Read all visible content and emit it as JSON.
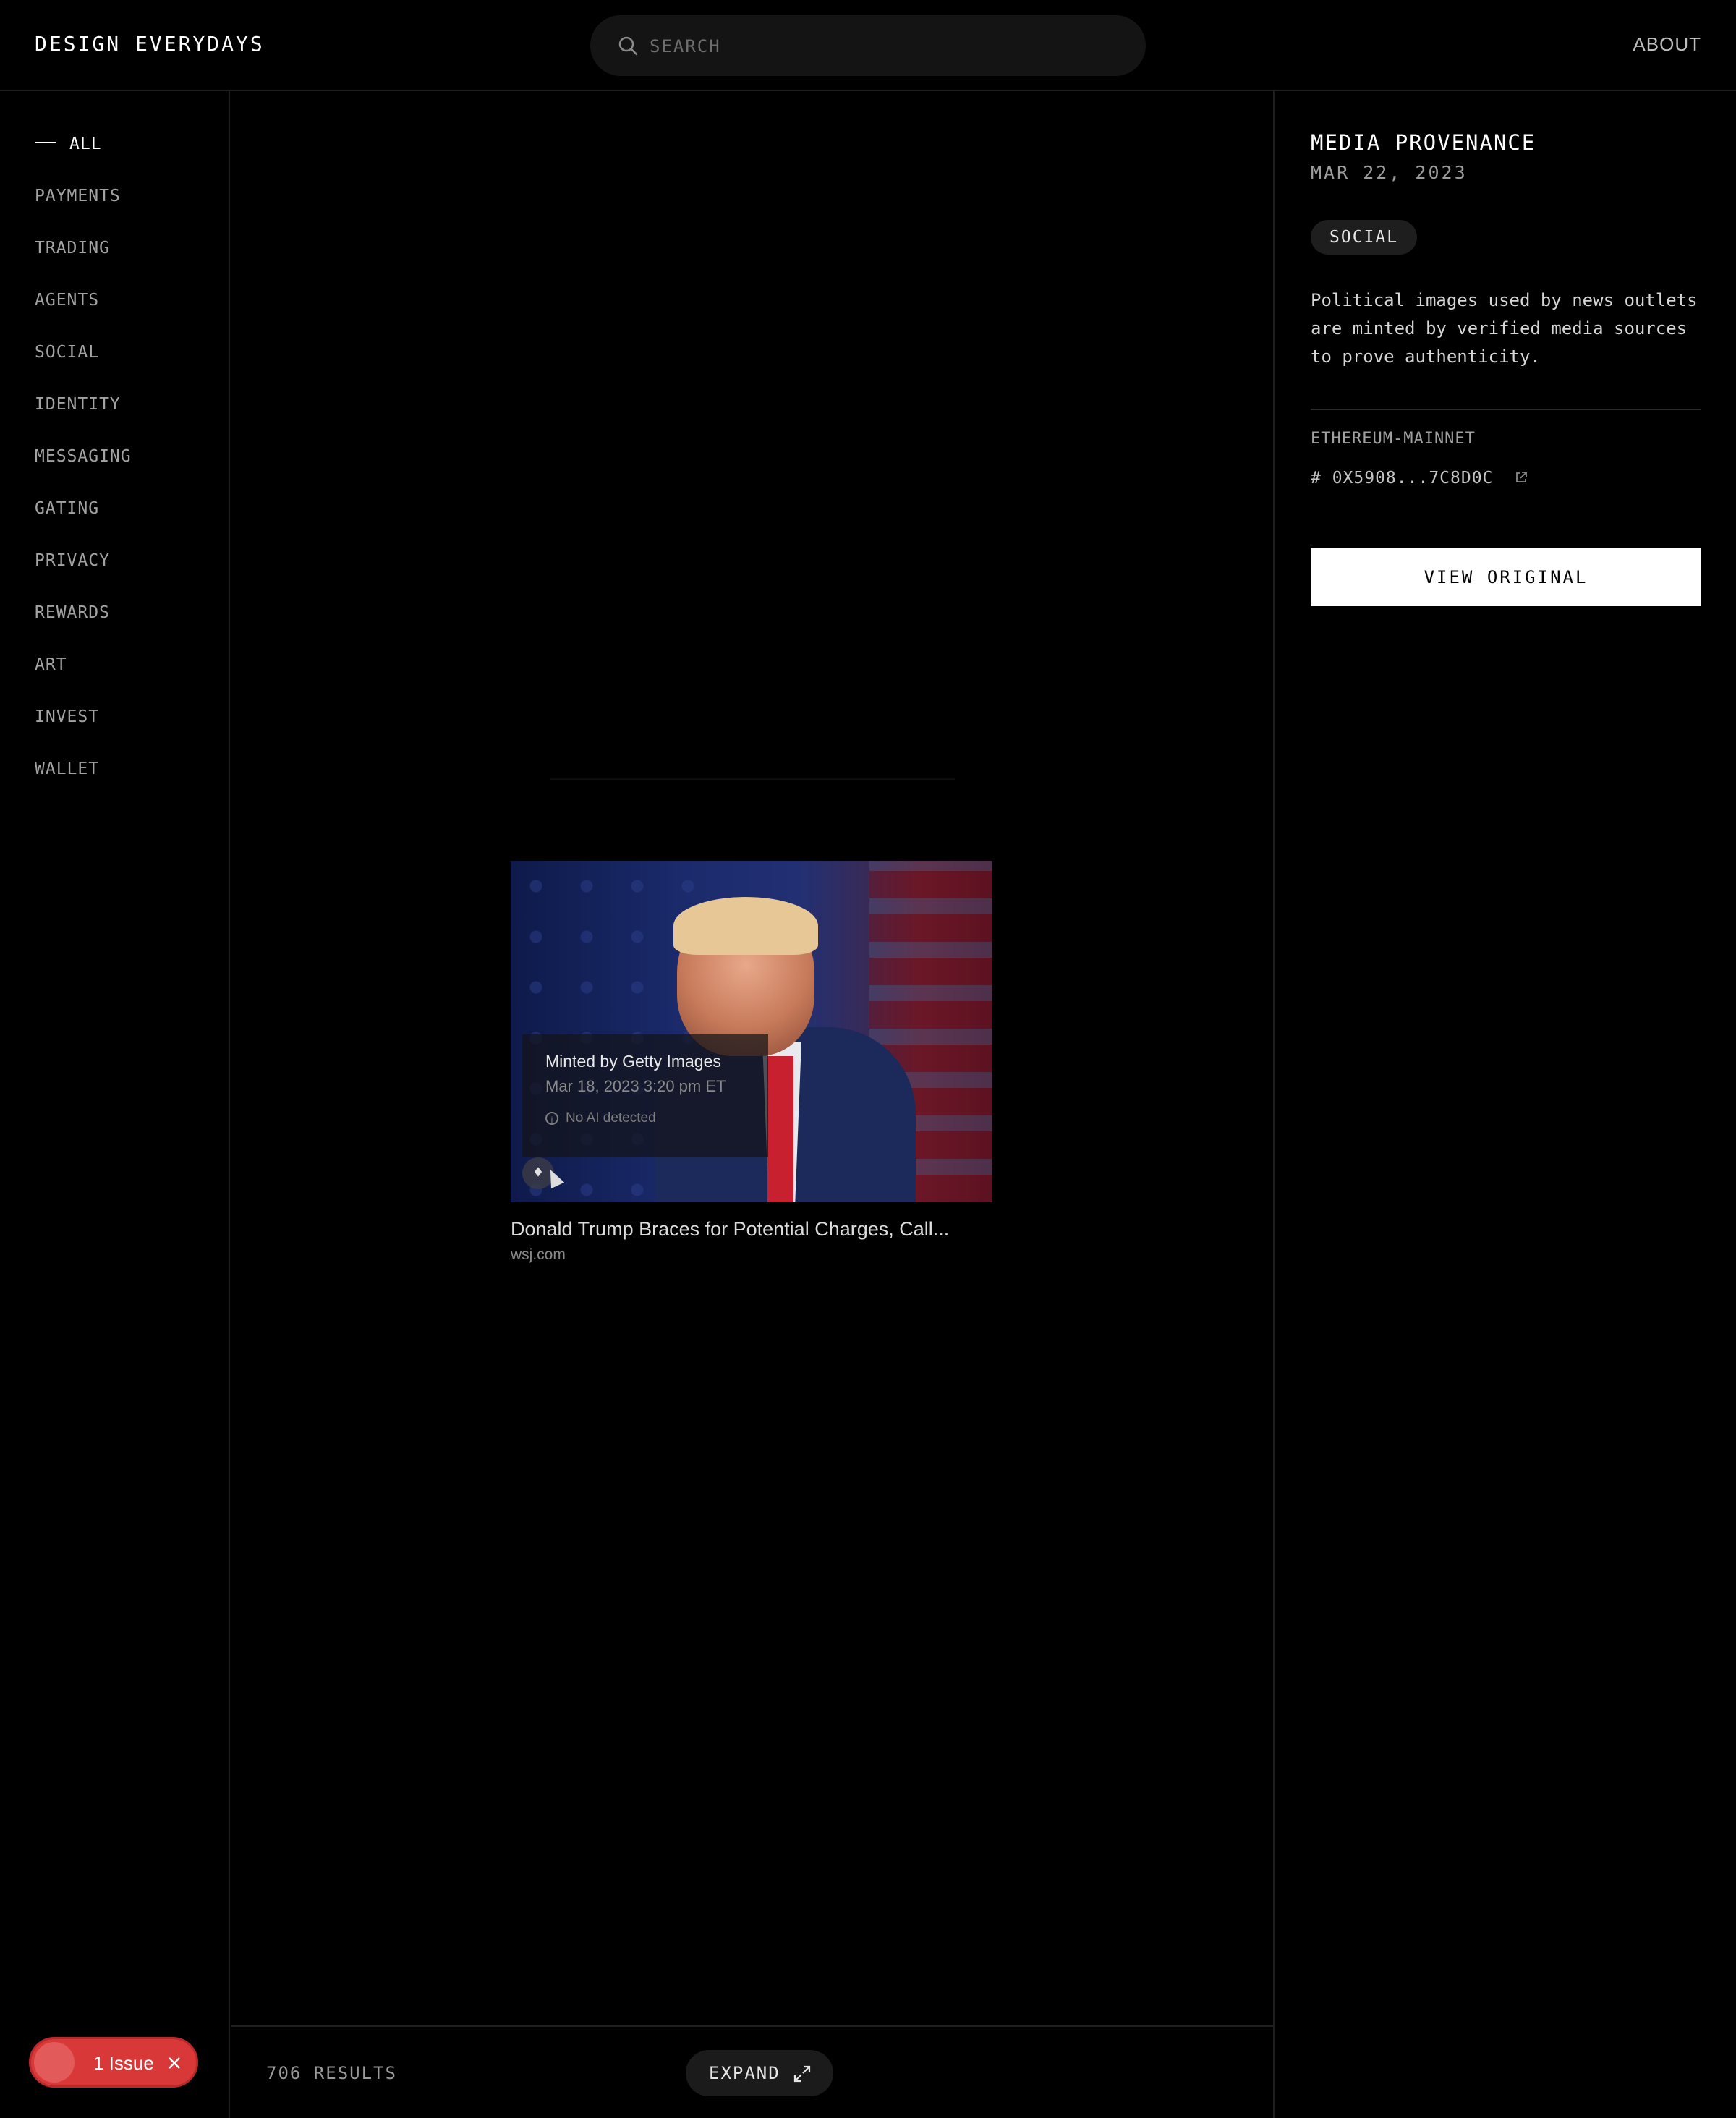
{
  "header": {
    "brand": "DESIGN EVERYDAYS",
    "search_placeholder": "SEARCH",
    "about_label": "ABOUT"
  },
  "sidebar": {
    "items": [
      {
        "label": "ALL",
        "active": true
      },
      {
        "label": "PAYMENTS"
      },
      {
        "label": "TRADING"
      },
      {
        "label": "AGENTS"
      },
      {
        "label": "SOCIAL"
      },
      {
        "label": "IDENTITY"
      },
      {
        "label": "MESSAGING"
      },
      {
        "label": "GATING"
      },
      {
        "label": "PRIVACY"
      },
      {
        "label": "REWARDS"
      },
      {
        "label": "ART"
      },
      {
        "label": "INVEST"
      },
      {
        "label": "WALLET"
      }
    ]
  },
  "card": {
    "overlay_title": "Minted by Getty Images",
    "overlay_date": "Mar 18, 2023 3:20 pm ET",
    "overlay_ai": "No AI detected",
    "title": "Donald Trump Braces for Potential Charges, Call...",
    "source": "wsj.com"
  },
  "bottombar": {
    "results": "706 RESULTS",
    "expand_label": "EXPAND"
  },
  "detail": {
    "title": "MEDIA PROVENANCE",
    "date": "MAR 22, 2023",
    "tag": "SOCIAL",
    "description": "Political images used by news outlets are minted by verified media sources to prove authenticity.",
    "chain": "ETHEREUM-MAINNET",
    "hash": "# 0X5908...7C8D0C",
    "view_button": "VIEW ORIGINAL"
  },
  "issue": {
    "label": "1 Issue"
  },
  "colors": {
    "background": "#000000",
    "issue_red": "#d93838",
    "button_bg": "#ffffff"
  }
}
